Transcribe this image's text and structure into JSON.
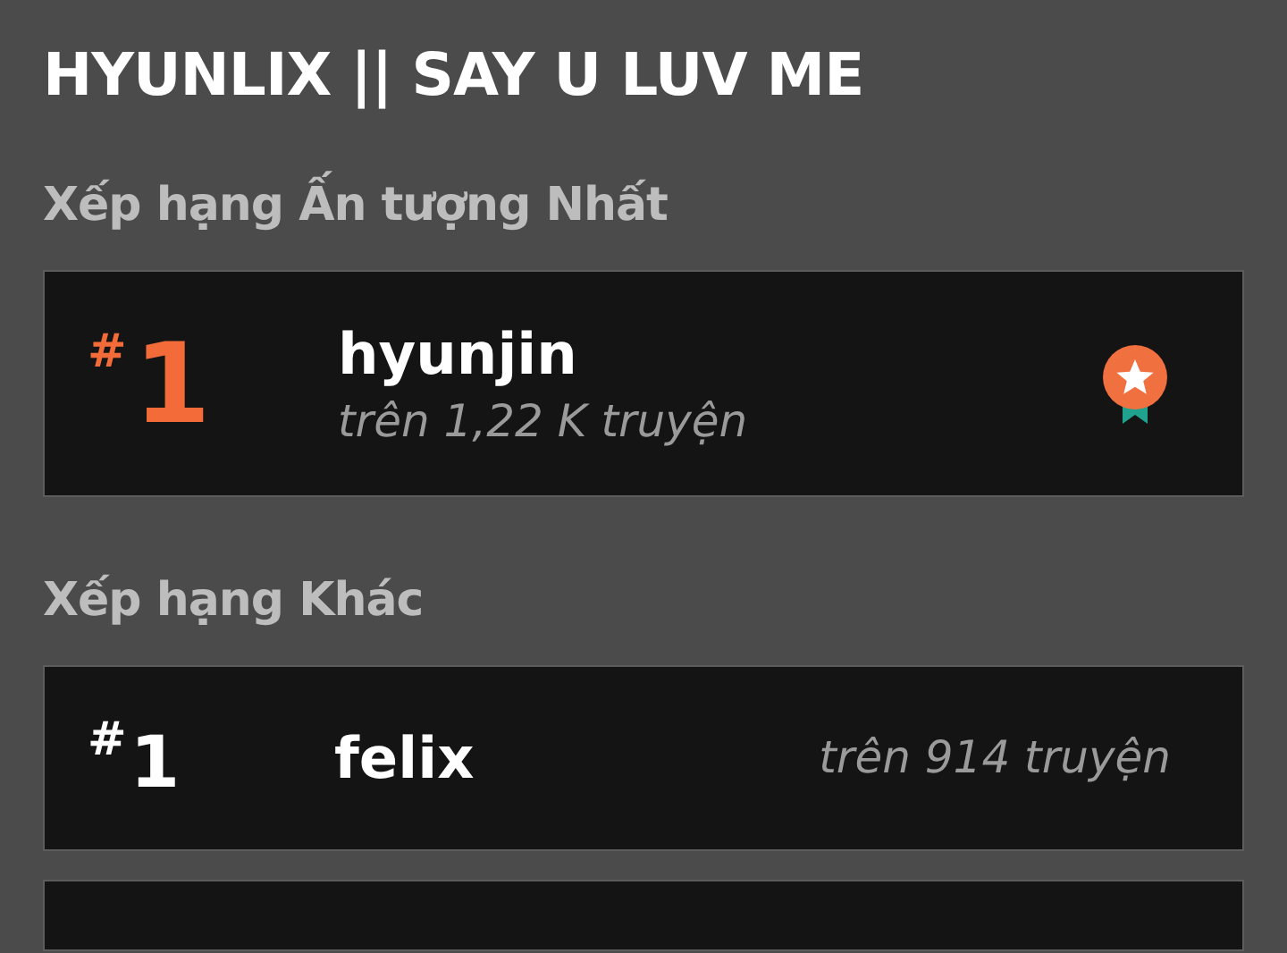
{
  "title": "HYUNLIX || SAY U LUV ME",
  "sections": [
    {
      "heading": "Xếp hạng Ấn tượng Nhất",
      "kind": "featured",
      "items": [
        {
          "hash": "#",
          "rank": "1",
          "name": "hyunjin",
          "count": "trên 1,22 K truyện"
        }
      ]
    },
    {
      "heading": "Xếp hạng Khác",
      "kind": "plain",
      "items": [
        {
          "hash": "#",
          "rank": "1",
          "name": "felix",
          "count": "trên 914 truyện"
        }
      ]
    }
  ]
}
